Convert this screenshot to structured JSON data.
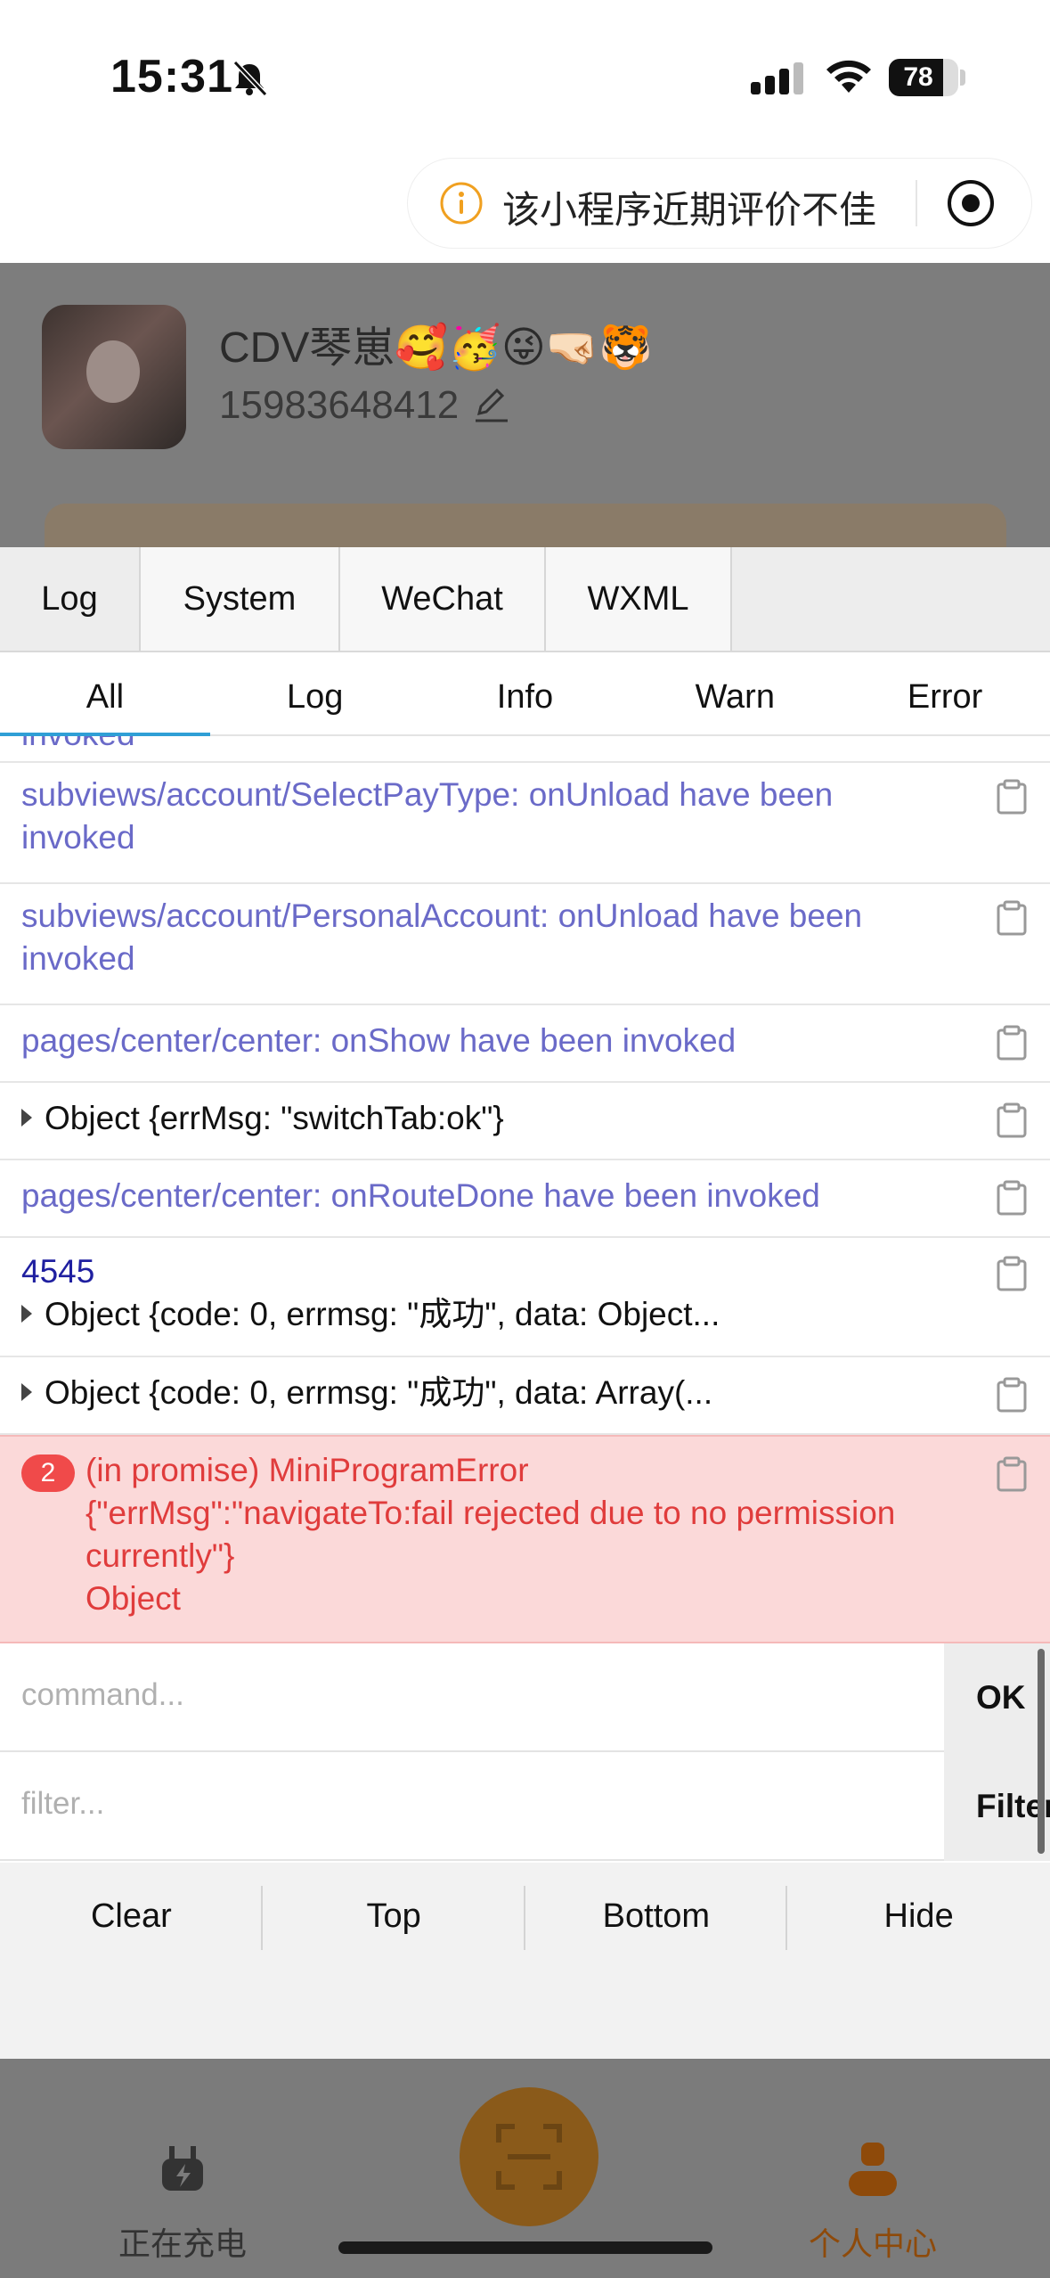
{
  "status_bar": {
    "time": "15:31",
    "battery": "78",
    "battery_level": 0.78
  },
  "capsule": {
    "warning_text": "该小程序近期评价不佳"
  },
  "profile": {
    "username": "CDV琴崽🥰🥳😜🤜🏻🐯",
    "phone": "15983648412"
  },
  "vconsole": {
    "tabs": [
      "Log",
      "System",
      "WeChat",
      "WXML"
    ],
    "subtabs": [
      "All",
      "Log",
      "Info",
      "Warn",
      "Error"
    ],
    "logs": [
      {
        "line1": "invoked"
      },
      {
        "line1": "subviews/account/SelectPayType: onUnload have been",
        "line2": "invoked"
      },
      {
        "line1": "subviews/account/PersonalAccount: onUnload have been",
        "line2": "invoked"
      },
      {
        "line1": "pages/center/center: onShow have been invoked"
      },
      {
        "line1": "Object {errMsg: \"switchTab:ok\"}"
      },
      {
        "line1": "pages/center/center: onRouteDone have been invoked"
      },
      {
        "line1": "4545",
        "line2": "Object {code: 0, errmsg: \"成功\", data: Object..."
      },
      {
        "line1": "Object {code: 0, errmsg: \"成功\", data: Array(..."
      }
    ],
    "error": {
      "count": "2",
      "line1": "(in promise) MiniProgramError",
      "line2": "{\"errMsg\":\"navigateTo:fail rejected due to no permission",
      "line3": "currently\"}",
      "line4": "Object"
    },
    "command_placeholder": "command...",
    "ok_label": "OK",
    "filter_placeholder": "filter...",
    "filter_label": "Filter",
    "toolbar": [
      "Clear",
      "Top",
      "Bottom",
      "Hide"
    ]
  },
  "tabbar": {
    "charging": "正在充电",
    "me": "个人中心"
  },
  "colors": {
    "accent_blue": "#2f9fd6",
    "log_blue": "#6a6ac8",
    "error_red": "#e03c3c",
    "error_bg": "#fbd9d9"
  }
}
